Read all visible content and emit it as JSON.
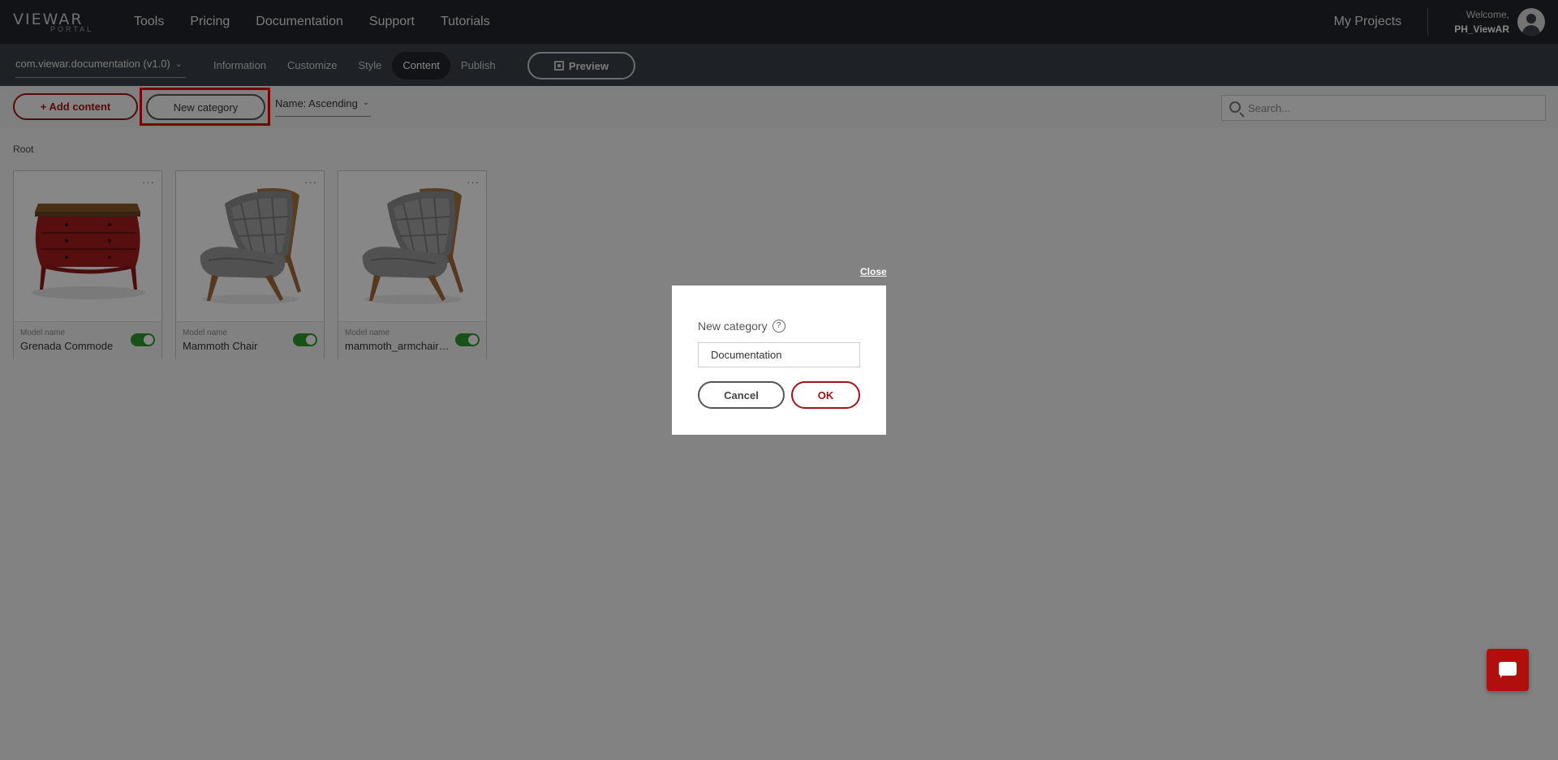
{
  "topnav": {
    "logo_main": "VIEWAR",
    "logo_sub": "PORTAL",
    "links": [
      "Tools",
      "Pricing",
      "Documentation",
      "Support",
      "Tutorials"
    ],
    "my_projects": "My Projects",
    "welcome_label": "Welcome,",
    "username": "PH_ViewAR"
  },
  "subnav": {
    "project": "com.viewar.documentation (v1.0)",
    "tabs": [
      "Information",
      "Customize",
      "Style",
      "Content",
      "Publish"
    ],
    "active_tab": "Content",
    "preview_label": "Preview"
  },
  "toolbar": {
    "add_content_label": "+ Add content",
    "new_category_label": "New category",
    "sort_label": "Name: Ascending",
    "search_placeholder": "Search..."
  },
  "content": {
    "breadcrumb": "Root",
    "cards": [
      {
        "label": "Model name",
        "name": "Grenada Commode",
        "enabled": true
      },
      {
        "label": "Model name",
        "name": "Mammoth Chair",
        "enabled": true
      },
      {
        "label": "Model name",
        "name": "mammoth_armchair_...",
        "enabled": true
      }
    ]
  },
  "modal": {
    "close_label": "Close",
    "title": "New category",
    "help_icon": "?",
    "input_value": "Documentation",
    "cancel_label": "Cancel",
    "ok_label": "OK"
  },
  "colors": {
    "topnav_bg": "#20242b",
    "subnav_bg": "#3a3f47",
    "accent_red": "#a01515",
    "toggle_green": "#2e9b2e",
    "highlight_box": "#e00000"
  }
}
